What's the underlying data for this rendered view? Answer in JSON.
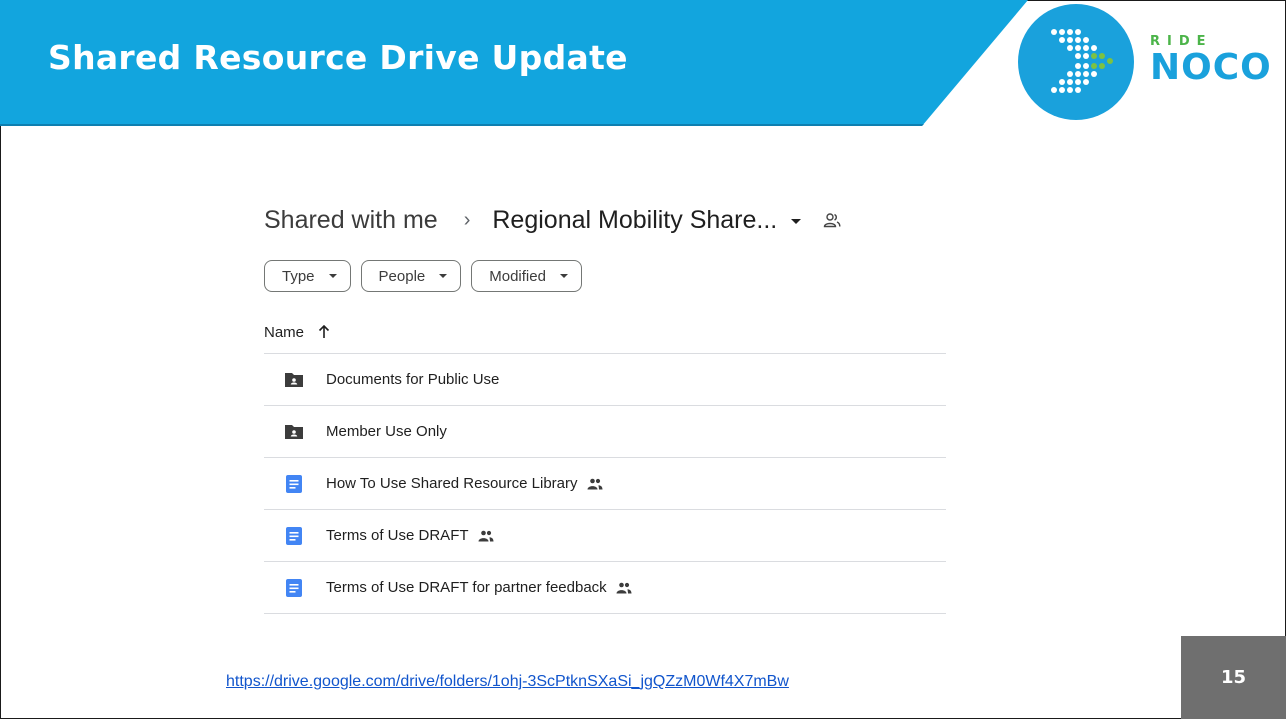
{
  "slide": {
    "title": "Shared Resource Drive Update",
    "page_number": "15",
    "link": "https://drive.google.com/drive/folders/1ohj-3ScPtknSXaSi_jgQZzM0Wf4X7mBw",
    "brand": {
      "top": "RIDE",
      "main": "NOCO"
    },
    "colors": {
      "title_bar": "#12a5de",
      "page_box": "#6f6f6f",
      "logo_circle": "#1aa1dc",
      "logo_dots": "#ffffff",
      "logo_accent": "#7dc242"
    }
  },
  "drive": {
    "breadcrumb": {
      "root": "Shared with me",
      "separator": "›",
      "folder": "Regional Mobility Share..."
    },
    "filters": [
      {
        "label": "Type"
      },
      {
        "label": "People"
      },
      {
        "label": "Modified"
      }
    ],
    "column_header": "Name",
    "items": [
      {
        "name": "Documents for Public Use",
        "icon": "shared-folder-icon",
        "shared": false
      },
      {
        "name": "Member Use Only",
        "icon": "shared-folder-icon",
        "shared": false
      },
      {
        "name": "How To Use Shared Resource Library",
        "icon": "google-doc-icon",
        "shared": true
      },
      {
        "name": "Terms of Use DRAFT",
        "icon": "google-doc-icon",
        "shared": true
      },
      {
        "name": "Terms of Use DRAFT for partner feedback",
        "icon": "google-doc-icon",
        "shared": true
      }
    ]
  }
}
